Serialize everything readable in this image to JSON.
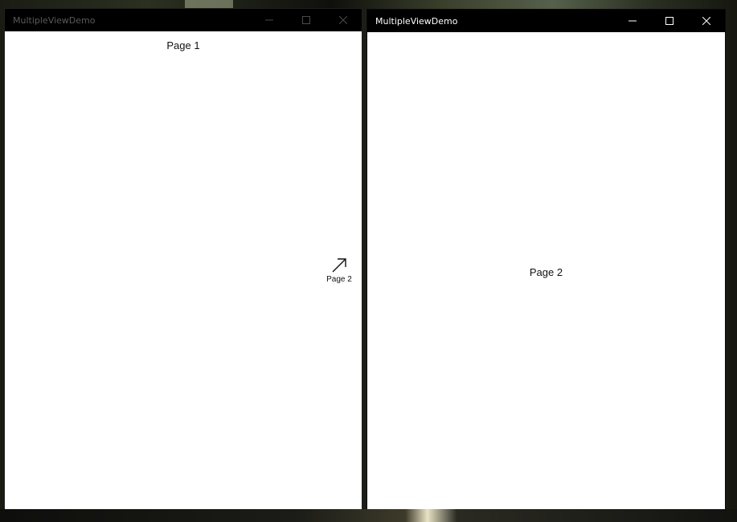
{
  "windows": [
    {
      "title": "MultipleViewDemo",
      "content_label": "Page 1",
      "active": false,
      "swap_hint_label": "Page 2"
    },
    {
      "title": "MultipleViewDemo",
      "content_label": "Page 2",
      "active": true
    }
  ],
  "icons": {
    "minimize": "minimize-icon",
    "maximize": "maximize-icon",
    "close": "close-icon",
    "arrow": "arrow-up-right-icon"
  },
  "colors": {
    "titlebar": "#000000",
    "inactive_title_text": "#5a5a5a",
    "active_title_text": "#ffffff",
    "content_bg": "#ffffff"
  }
}
